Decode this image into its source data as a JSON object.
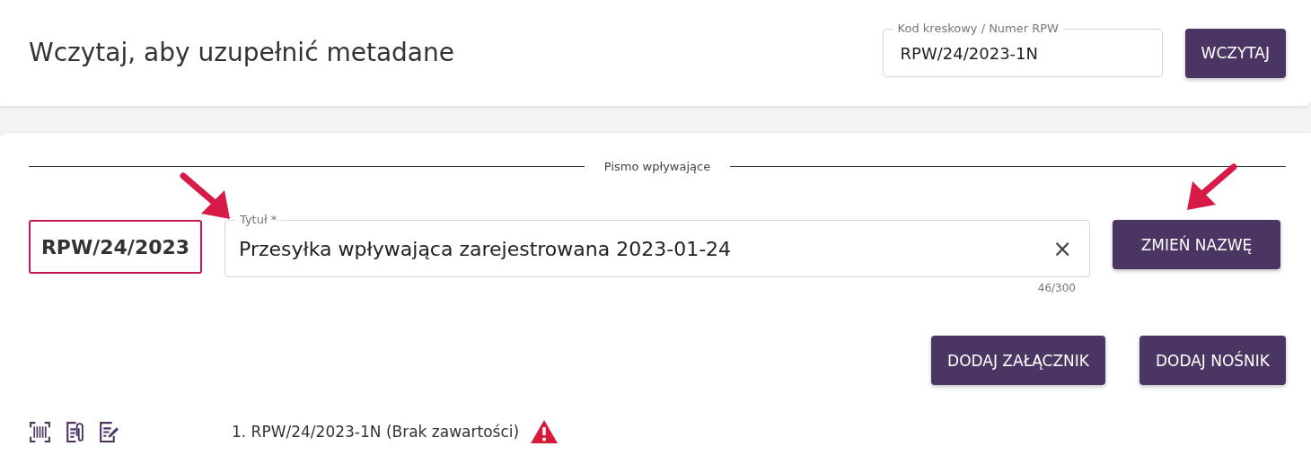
{
  "load_card": {
    "title": "Wczytaj, aby uzupełnić metadane",
    "field": {
      "label": "Kod kreskowy / Numer RPW",
      "value": "RPW/24/2023-1N"
    },
    "button": "WCZYTAJ"
  },
  "document": {
    "section_title": "Pismo wpływające",
    "number": "RPW/24/2023",
    "title_field": {
      "label": "Tytuł *",
      "value": "Przesyłka wpływająca zarejestrowana 2023-01-24",
      "clear": "×",
      "counter": "46/300"
    },
    "rename_button": "ZMIEŃ NAZWĘ",
    "actions": [
      "DODAJ ZAŁĄCZNIK",
      "DODAJ NOŚNIK"
    ],
    "tools": [
      {
        "kind": "barcode"
      },
      {
        "kind": "attachment"
      },
      {
        "kind": "edit"
      }
    ],
    "items": [
      {
        "text": "1. RPW/24/2023-1N (Brak zawartości)",
        "warning": true
      }
    ]
  },
  "annotations": [
    {
      "kind": "arrow_right"
    },
    {
      "kind": "arrow_left"
    }
  ]
}
